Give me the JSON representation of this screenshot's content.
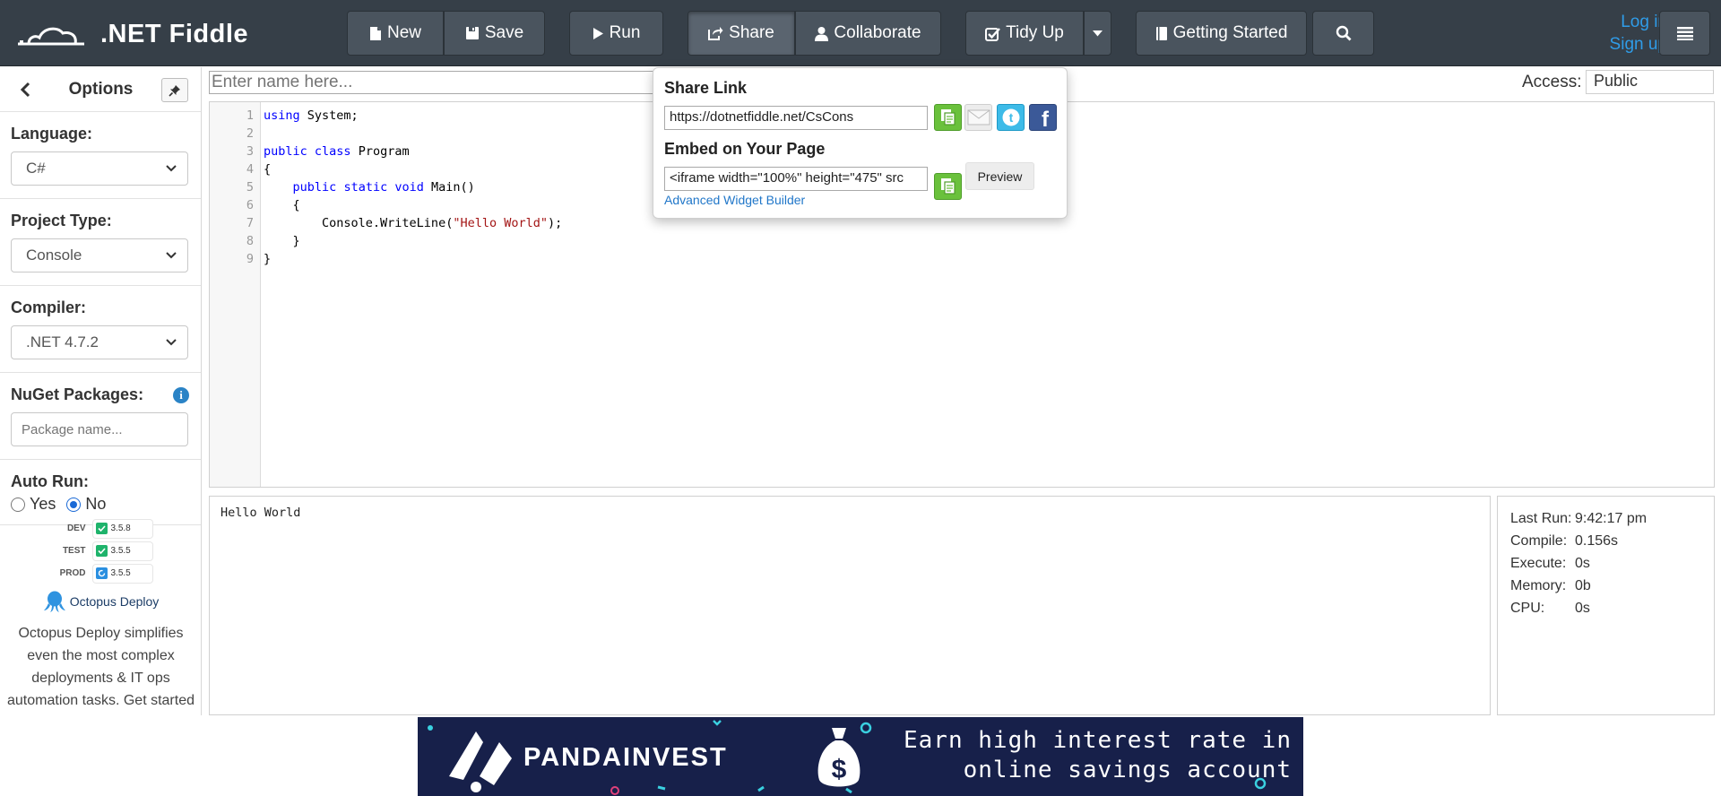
{
  "brand": {
    "name": ".NET Fiddle"
  },
  "toolbar": {
    "new_label": "New",
    "save_label": "Save",
    "run_label": "Run",
    "share_label": "Share",
    "collaborate_label": "Collaborate",
    "tidy_label": "Tidy Up",
    "getting_started_label": "Getting Started"
  },
  "auth": {
    "login": "Log in",
    "signup": "Sign up"
  },
  "sidebar": {
    "title": "Options",
    "language": {
      "label": "Language:",
      "value": "C#"
    },
    "project_type": {
      "label": "Project Type:",
      "value": "Console"
    },
    "compiler": {
      "label": "Compiler:",
      "value": ".NET 4.7.2"
    },
    "nuget": {
      "label": "NuGet Packages:",
      "placeholder": "Package name..."
    },
    "auto_run": {
      "label": "Auto Run:",
      "yes": "Yes",
      "no": "No",
      "selected": "No"
    },
    "ad": {
      "envs": [
        {
          "name": "DEV",
          "version": "3.5.8",
          "color": "#1eb36b"
        },
        {
          "name": "TEST",
          "version": "3.5.5",
          "color": "#1eb36b"
        },
        {
          "name": "PROD",
          "version": "3.5.5",
          "color": "#2a8fe0"
        }
      ],
      "brand": "Octopus Deploy",
      "text": "Octopus Deploy simplifies even the most complex deployments & IT ops automation tasks. Get started"
    }
  },
  "editor": {
    "name_placeholder": "Enter name here...",
    "access_label": "Access:",
    "access_value": "Public",
    "lines": [
      {
        "n": "1",
        "tokens": [
          {
            "t": "kw",
            "v": "using"
          },
          {
            "t": "txt",
            "v": " System;"
          }
        ]
      },
      {
        "n": "2",
        "tokens": []
      },
      {
        "n": "3",
        "tokens": [
          {
            "t": "kw",
            "v": "public"
          },
          {
            "t": "txt",
            "v": " "
          },
          {
            "t": "kw",
            "v": "class"
          },
          {
            "t": "txt",
            "v": " Program"
          }
        ]
      },
      {
        "n": "4",
        "tokens": [
          {
            "t": "txt",
            "v": "{"
          }
        ]
      },
      {
        "n": "5",
        "tokens": [
          {
            "t": "txt",
            "v": "    "
          },
          {
            "t": "kw",
            "v": "public"
          },
          {
            "t": "txt",
            "v": " "
          },
          {
            "t": "kw",
            "v": "static"
          },
          {
            "t": "txt",
            "v": " "
          },
          {
            "t": "kw",
            "v": "void"
          },
          {
            "t": "txt",
            "v": " Main()"
          }
        ]
      },
      {
        "n": "6",
        "tokens": [
          {
            "t": "txt",
            "v": "    {"
          }
        ]
      },
      {
        "n": "7",
        "tokens": [
          {
            "t": "txt",
            "v": "        Console.WriteLine("
          },
          {
            "t": "str",
            "v": "\"Hello World\""
          },
          {
            "t": "txt",
            "v": ");"
          }
        ]
      },
      {
        "n": "8",
        "tokens": [
          {
            "t": "txt",
            "v": "    }"
          }
        ]
      },
      {
        "n": "9",
        "tokens": [
          {
            "t": "txt",
            "v": "}"
          }
        ]
      }
    ]
  },
  "share": {
    "link_title": "Share Link",
    "link_value": "https://dotnetfiddle.net/CsCons",
    "embed_title": "Embed on Your Page",
    "embed_value": "<iframe width=\"100%\" height=\"475\" src",
    "preview_label": "Preview",
    "advanced_link": "Advanced Widget Builder"
  },
  "output": {
    "text": "Hello World"
  },
  "stats": [
    {
      "k": "Last Run:",
      "v": "9:42:17 pm"
    },
    {
      "k": "Compile:",
      "v": "0.156s"
    },
    {
      "k": "Execute:",
      "v": "0s"
    },
    {
      "k": "Memory:",
      "v": "0b"
    },
    {
      "k": "CPU:",
      "v": "0s"
    }
  ],
  "banner": {
    "brand": "PANDAINVEST",
    "line1": "Earn high interest rate in",
    "line2": "online savings account"
  },
  "colors": {
    "navbar": "#363f48",
    "nav_button": "#4a545e",
    "link": "#2f9ce8",
    "keyword": "#0000ff",
    "string": "#a31515",
    "copy_green": "#6ac13c",
    "banner_bg": "#17204a"
  }
}
